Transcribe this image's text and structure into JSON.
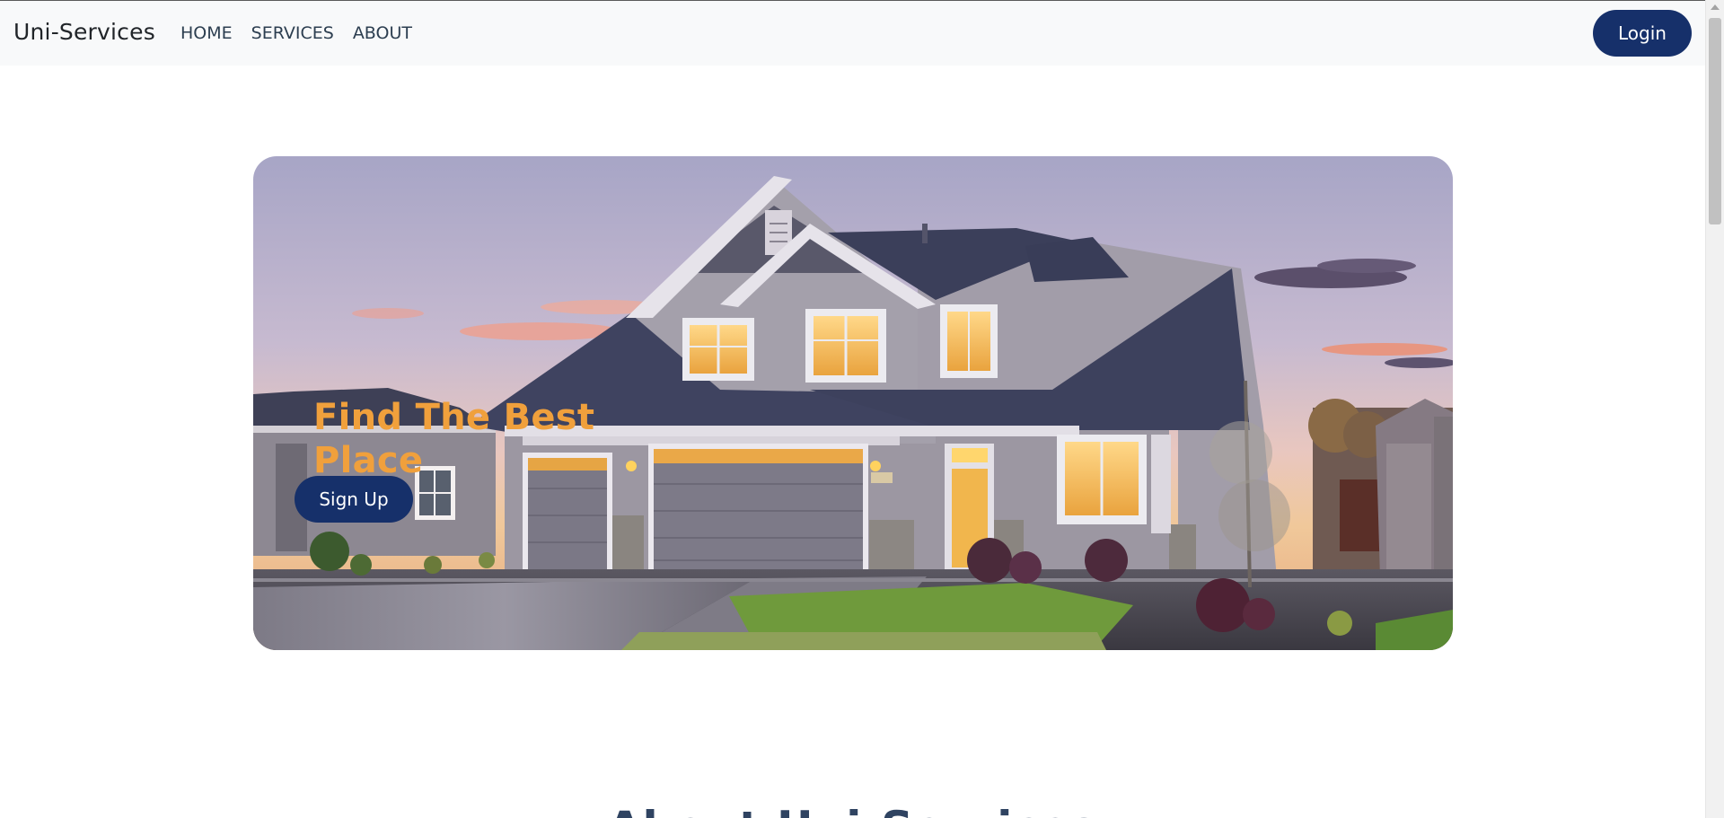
{
  "navbar": {
    "brand": "Uni-Services",
    "links": [
      {
        "label": "HOME"
      },
      {
        "label": "SERVICES"
      },
      {
        "label": "ABOUT"
      }
    ],
    "login_label": "Login"
  },
  "hero": {
    "title": "Find The Best Place",
    "signup_label": "Sign Up",
    "image": "suburban-house-at-dusk"
  },
  "about": {
    "title": "About Uni-Services"
  },
  "colors": {
    "primary": "#16306a",
    "accent": "#f0a03c",
    "nav_bg": "#f8f9fa",
    "heading": "#2f4361"
  }
}
